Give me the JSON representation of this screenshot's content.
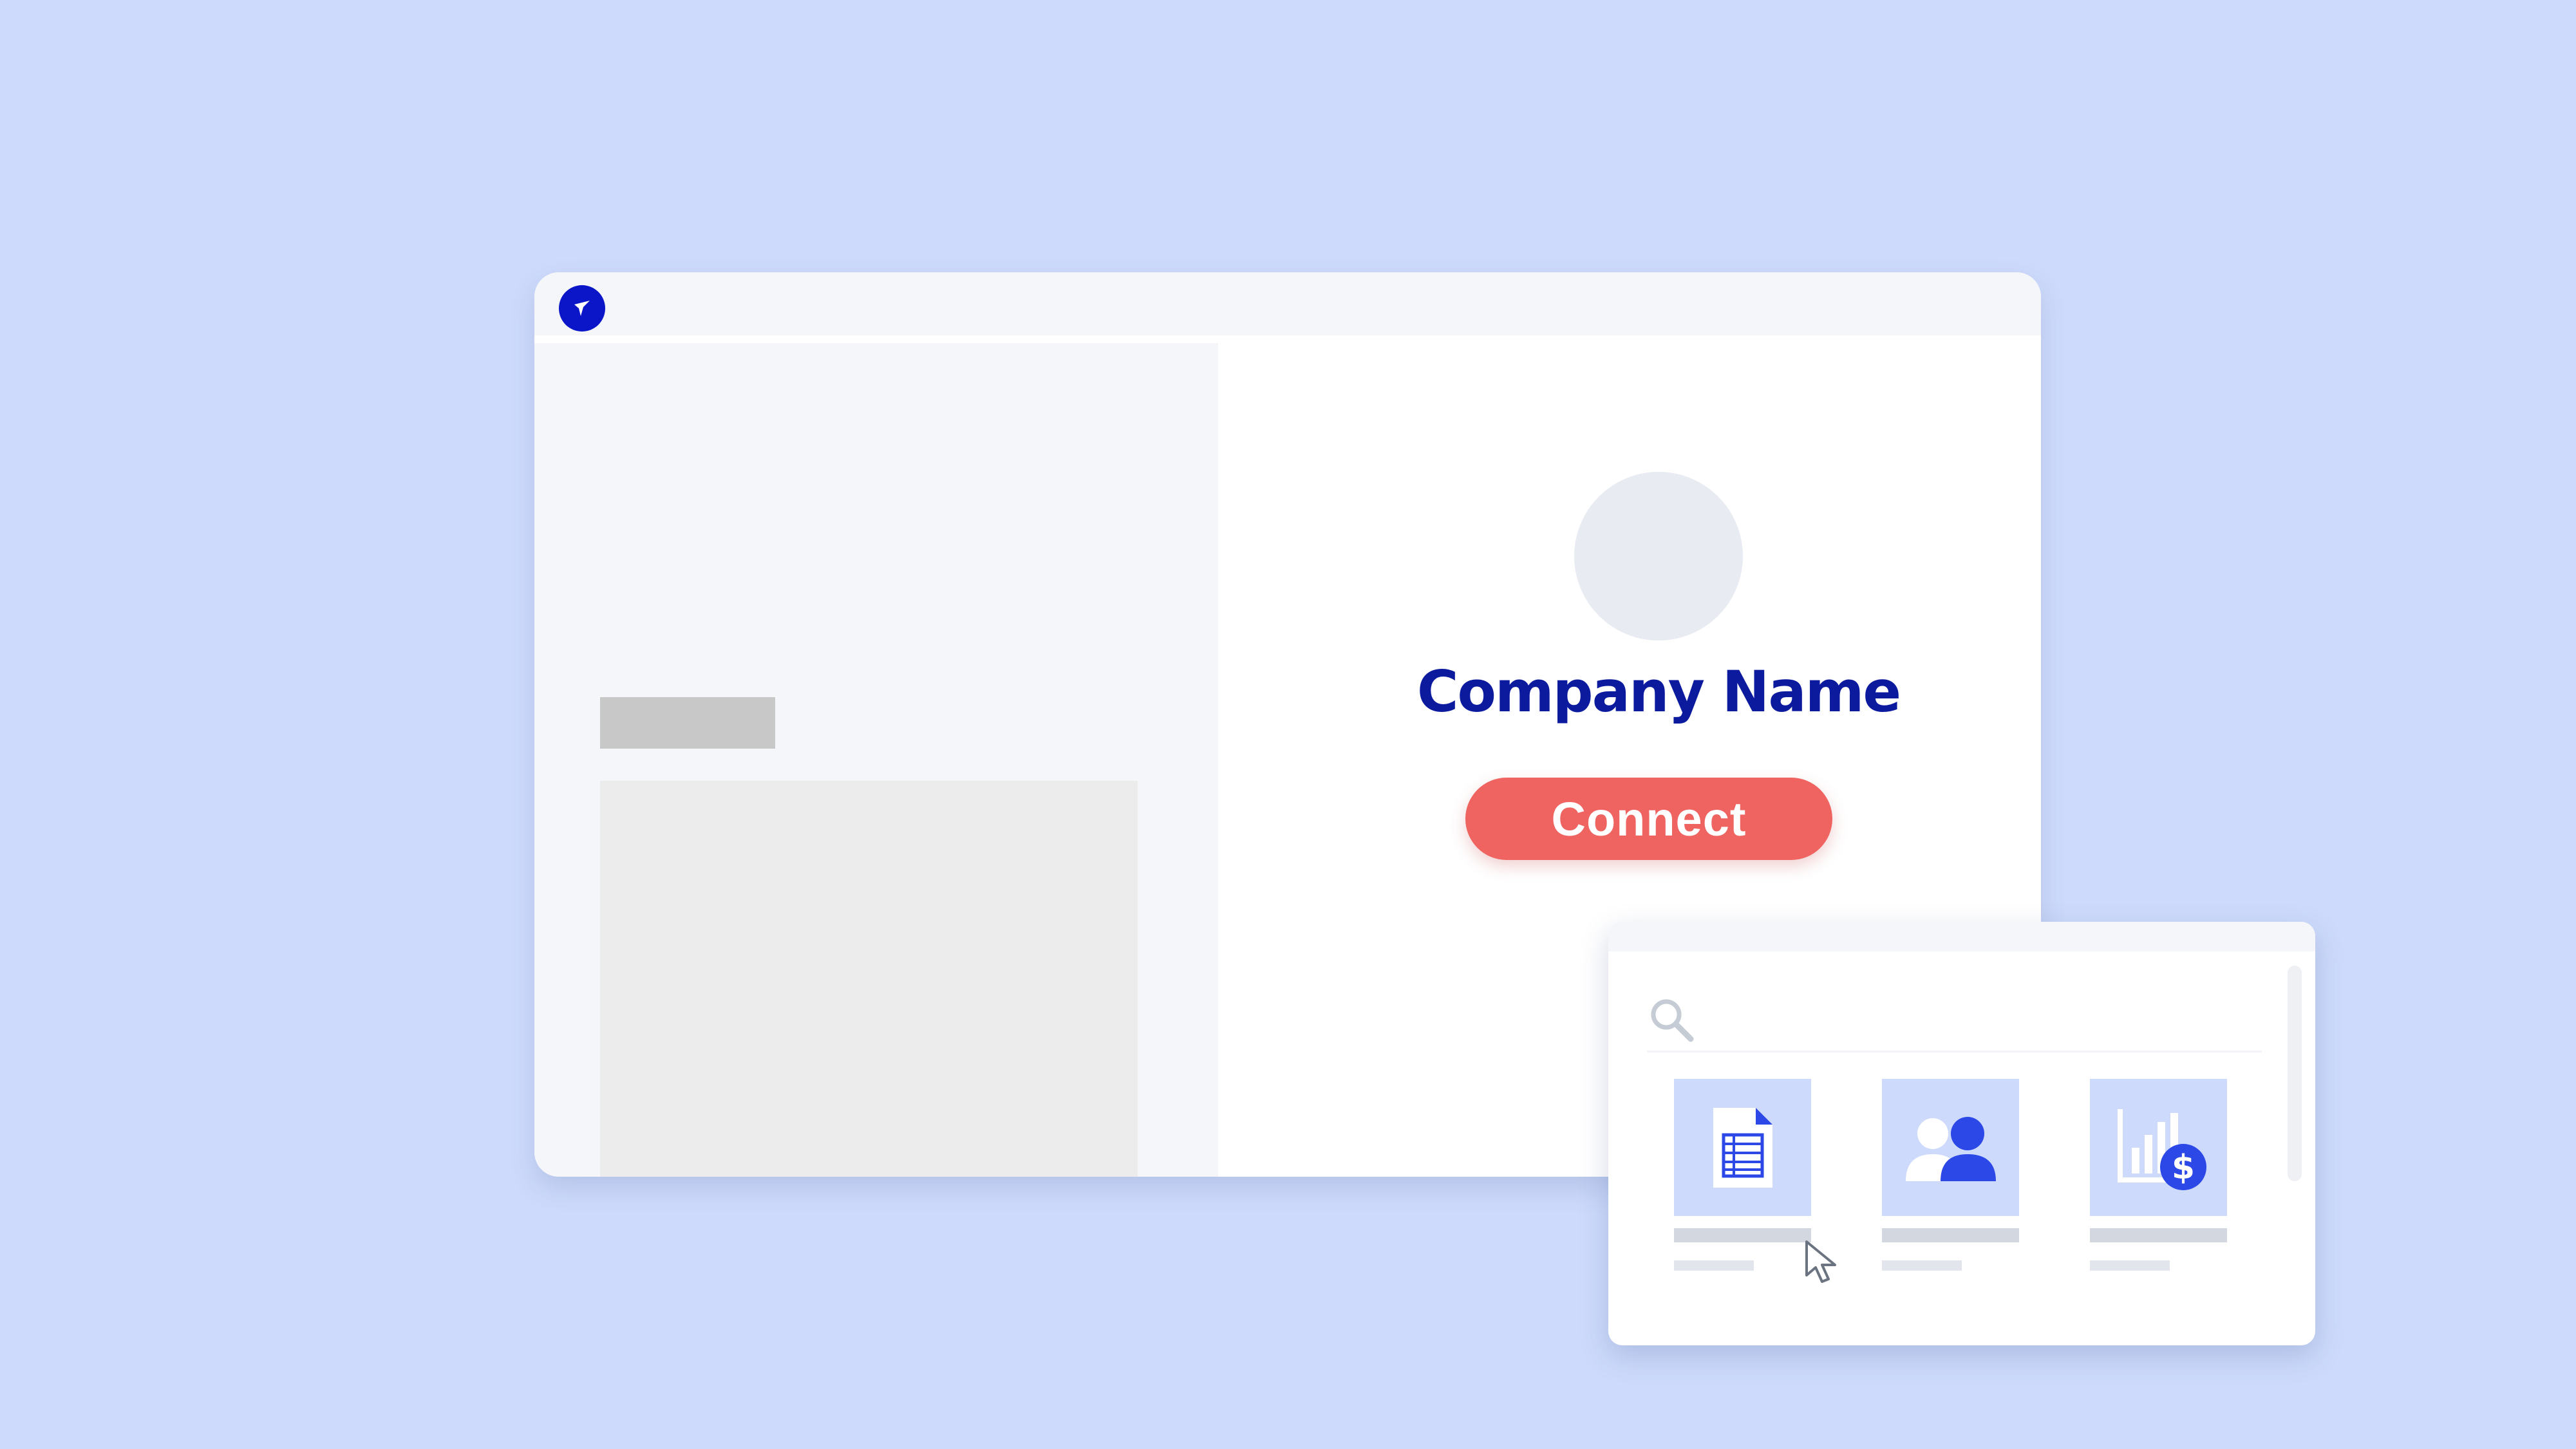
{
  "company": {
    "name": "Company Name",
    "connect_label": "Connect"
  },
  "picker": {
    "items": [
      {
        "icon": "spreadsheet-document-icon"
      },
      {
        "icon": "users-group-icon"
      },
      {
        "icon": "financial-report-chart-icon"
      }
    ]
  },
  "colors": {
    "background": "#cddafb",
    "brand_dark_blue": "#0c1a9e",
    "brand_blue": "#0b16c8",
    "icon_blue": "#2c49e8",
    "connect_button": "#ef6461"
  }
}
